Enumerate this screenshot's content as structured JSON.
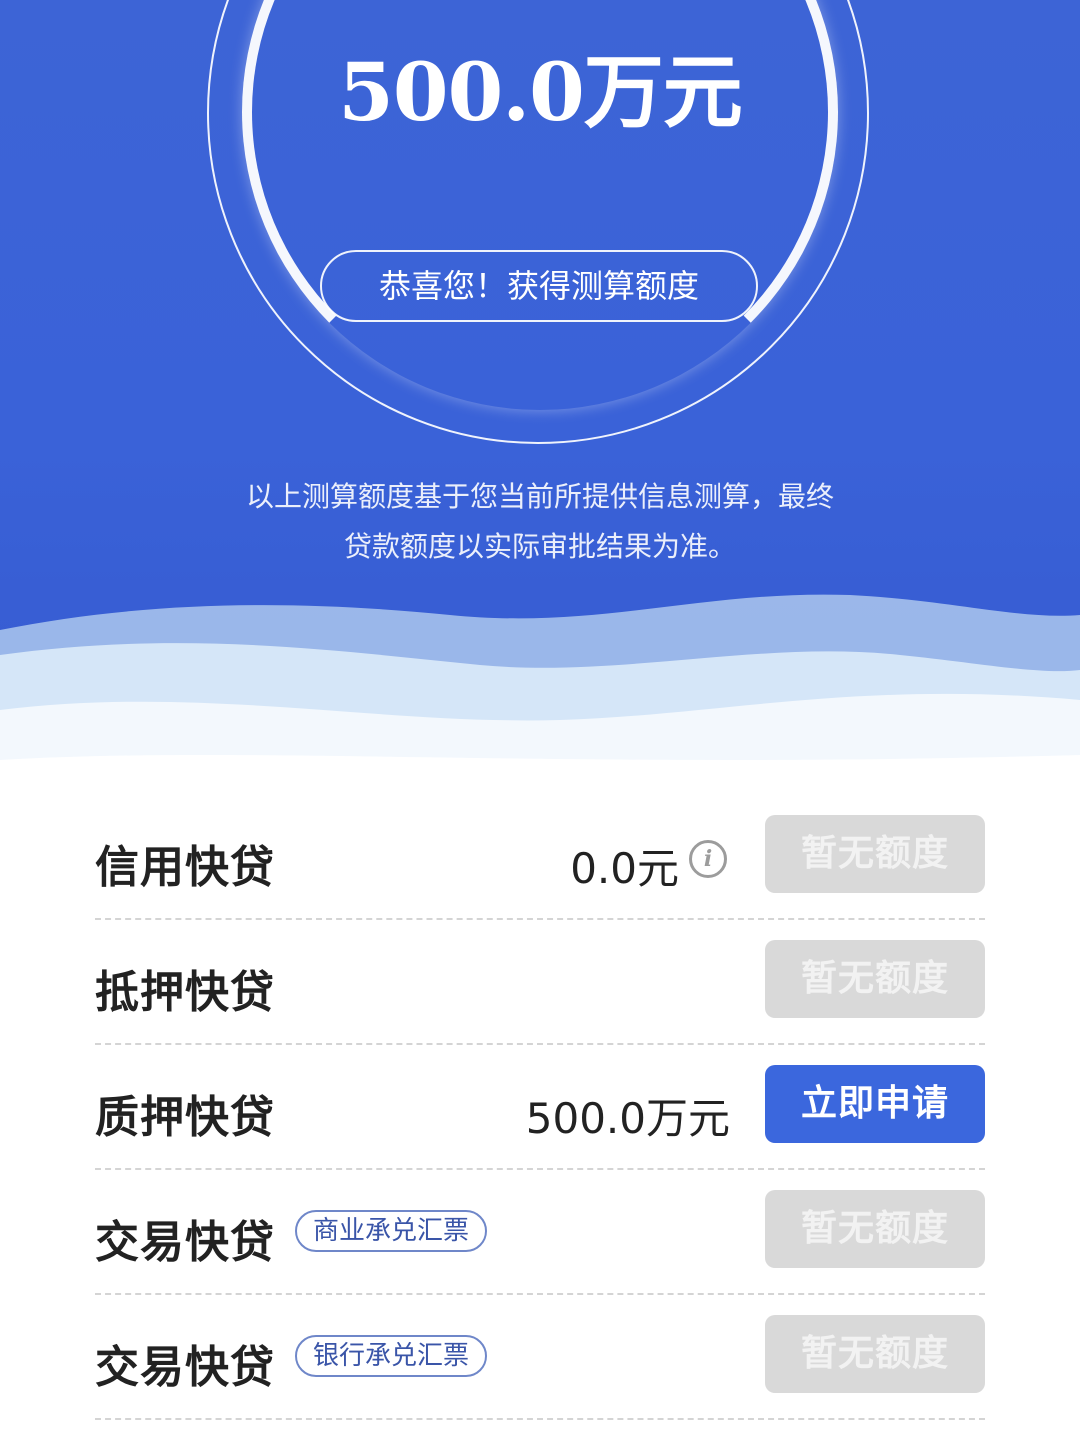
{
  "hero": {
    "amount": "500.0万元",
    "congrats": "恭喜您！获得测算额度",
    "disclaimer_line1": "以上测算额度基于您当前所提供信息测算，最终",
    "disclaimer_line2": "贷款额度以实际审批结果为准。"
  },
  "products": [
    {
      "name": "信用快贷",
      "tag": "",
      "value": "0.0元",
      "button": "暂无额度"
    },
    {
      "name": "抵押快贷",
      "tag": "",
      "value": "",
      "button": "暂无额度"
    },
    {
      "name": "质押快贷",
      "tag": "",
      "value": "500.0万元",
      "button": "立即申请"
    },
    {
      "name": "交易快贷",
      "tag": "商业承兑汇票",
      "value": "",
      "button": "暂无额度"
    },
    {
      "name": "交易快贷",
      "tag": "银行承兑汇票",
      "value": "",
      "button": "暂无额度"
    }
  ],
  "colors": {
    "hero_blue": "#3d64d6",
    "button_active": "#3b67dd",
    "button_disabled": "#d9d9d9"
  },
  "icons": {
    "info": "info-icon"
  }
}
